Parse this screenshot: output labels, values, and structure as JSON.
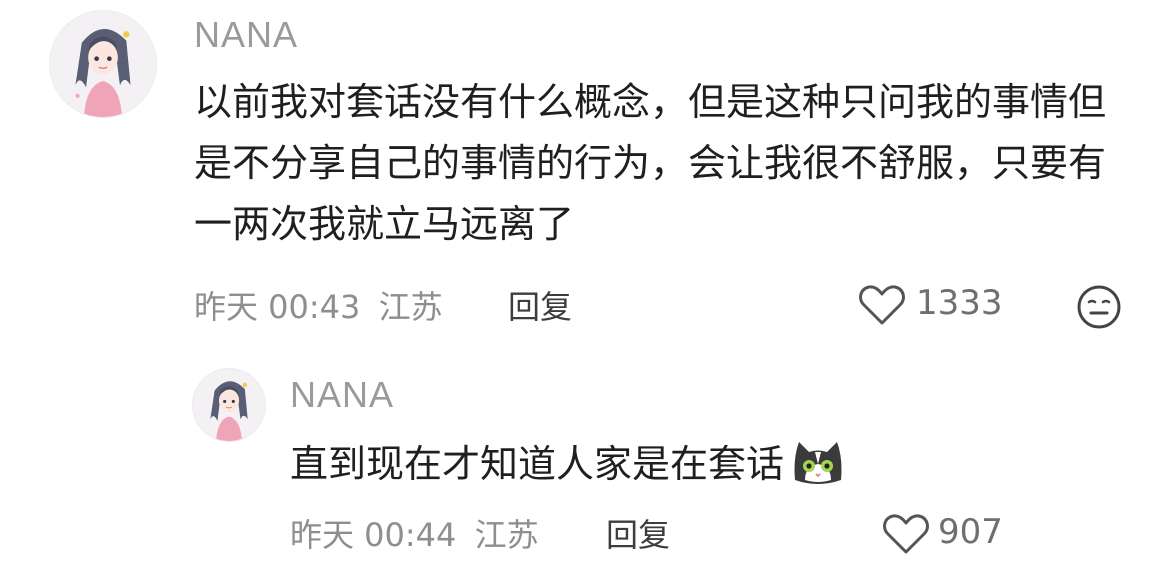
{
  "comment": {
    "username": "NANA",
    "text": "以前我对套话没有什么概念，但是这种只问我的事情但是不分享自己的事情的行为，会让我很不舒服，只要有一两次我就立马远离了",
    "time": "昨天 00:43",
    "location": "江苏",
    "reply_label": "回复",
    "likes": "1333"
  },
  "reply": {
    "username": "NANA",
    "text": "直到现在才知道人家是在套话",
    "time": "昨天 00:44",
    "location": "江苏",
    "reply_label": "回复",
    "likes": "907"
  },
  "icons": {
    "like": "heart-outline-icon",
    "expression": "neutral-face-icon",
    "emoji": "cat-emoji-icon"
  }
}
